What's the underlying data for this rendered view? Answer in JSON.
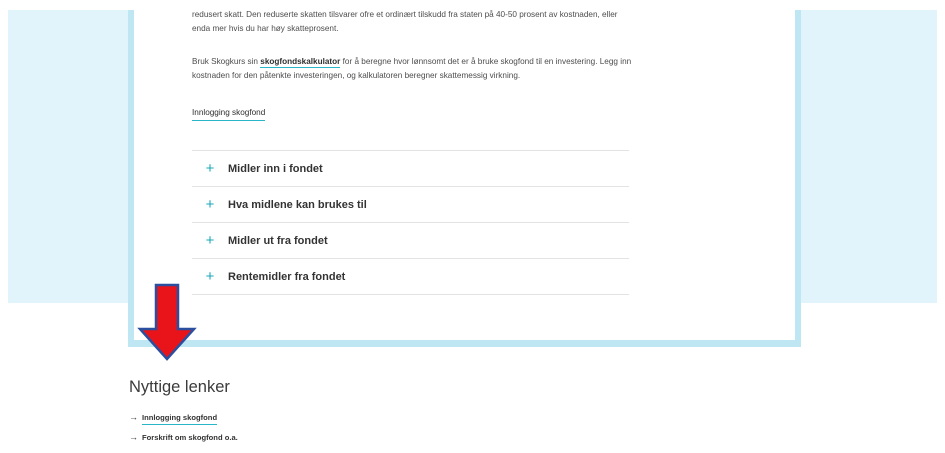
{
  "article": {
    "paragraph1": "redusert skatt. Den reduserte skatten tilsvarer ofre et ordinært tilskudd fra staten på 40-50 prosent av kostnaden, eller enda mer hvis du har høy skatteprosent.",
    "paragraph2_before": "Bruk Skogkurs sin ",
    "paragraph2_link": "skogfondskalkulator",
    "paragraph2_after": " for å beregne hvor lønnsomt det er å bruke skogfond til en investering. Legg inn kostnaden for den påtenkte investeringen, og kalkulatoren beregner skattemessig virkning.",
    "login_link": "Innlogging skogfond"
  },
  "accordion": {
    "items": [
      {
        "icon": "plus-icon",
        "label": "Midler inn i fondet"
      },
      {
        "icon": "plus-icon",
        "label": "Hva midlene kan brukes til"
      },
      {
        "icon": "plus-icon",
        "label": "Midler ut fra fondet"
      },
      {
        "icon": "plus-icon",
        "label": "Rentemidler fra fondet"
      }
    ]
  },
  "annotation": {
    "icon": "down-arrow-icon",
    "color": "#e8141a",
    "outline": "#2b4f9e"
  },
  "useful_links": {
    "title": "Nyttige lenker",
    "items": [
      {
        "icon": "right-arrow-icon",
        "label": "Innlogging skogfond"
      },
      {
        "icon": "right-arrow-icon",
        "label": "Forskrift om skogfond o.a."
      }
    ]
  },
  "colors": {
    "band_background": "#e2f4fb",
    "card_frame": "#bfe6f3",
    "accent": "#29b6c9",
    "plus": "#1aa7bb"
  }
}
